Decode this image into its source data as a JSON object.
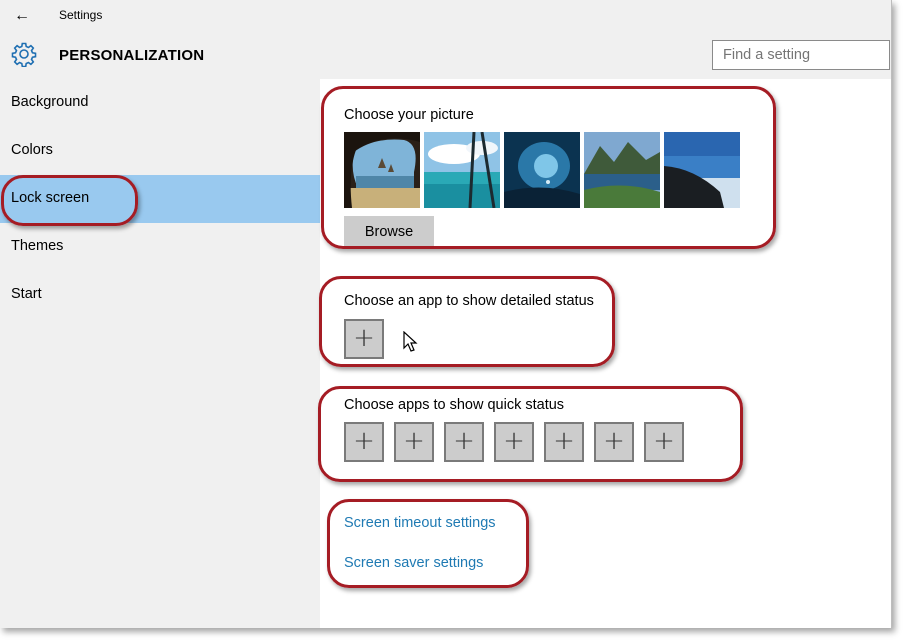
{
  "titlebar": {
    "back_icon": "back-arrow-icon",
    "title": "Settings"
  },
  "header": {
    "icon": "gear-icon",
    "section": "PERSONALIZATION",
    "search_placeholder": "Find a setting"
  },
  "sidebar": {
    "items": [
      {
        "label": "Background",
        "selected": false
      },
      {
        "label": "Colors",
        "selected": false
      },
      {
        "label": "Lock screen",
        "selected": true
      },
      {
        "label": "Themes",
        "selected": false
      },
      {
        "label": "Start",
        "selected": false
      }
    ]
  },
  "picture": {
    "heading": "Choose your picture",
    "thumbnails": [
      "beach-cave-photo",
      "aerial-lagoon-photo",
      "ice-cave-photo",
      "mountain-lake-photo",
      "cliff-sea-photo"
    ],
    "browse_label": "Browse"
  },
  "detailed_status": {
    "heading": "Choose an app to show detailed status",
    "add_icon": "plus-icon"
  },
  "quick_status": {
    "heading": "Choose apps to show quick status",
    "slot_count": 7,
    "add_icon": "plus-icon"
  },
  "links": {
    "timeout": "Screen timeout settings",
    "saver": "Screen saver settings"
  },
  "colors": {
    "chrome_bg": "#f0f0f0",
    "selected_bg": "#99c9ef",
    "link": "#1f7ab3",
    "button_bg": "#cccccc",
    "annotation": "#a51c24"
  }
}
